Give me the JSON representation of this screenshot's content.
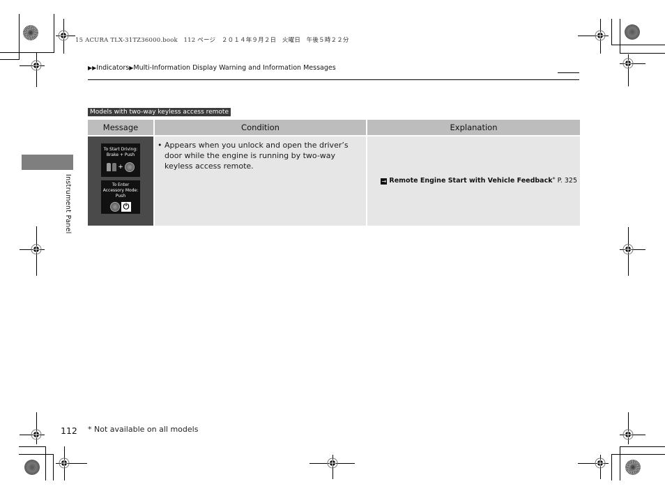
{
  "print_header": "15 ACURA TLX-31TZ36000.book　112 ページ　２０１４年９月２日　火曜日　午後５時２２分",
  "breadcrumb": {
    "arrows": "▶▶",
    "items": [
      "Indicators",
      "Multi-Information Display Warning and Information Messages"
    ],
    "separator": "▶"
  },
  "side_tab": {
    "label": "Instrument Panel"
  },
  "models_badge": "Models with two-way keyless access remote",
  "table": {
    "headers": [
      "Message",
      "Condition",
      "Explanation"
    ],
    "rows": [
      {
        "message": {
          "display1": {
            "line1": "To Start Driving:",
            "line2": "Brake + Push",
            "plus": "+"
          },
          "display2": {
            "line1": "To Enter",
            "line2": "Accessory Mode:",
            "line3": "Push",
            "power_symbol": "⏻"
          }
        },
        "condition": {
          "bullet": "•",
          "text": "Appears when you unlock and open the driver’s door while the engine is running by two-way keyless access remote."
        },
        "explanation": {
          "xref_arrow": "→",
          "xref_title": "Remote Engine Start with Vehicle Feedback",
          "xref_star": "*",
          "xref_page": "P. 325"
        }
      }
    ]
  },
  "page_number": "112",
  "footnote": "* Not available on all models"
}
